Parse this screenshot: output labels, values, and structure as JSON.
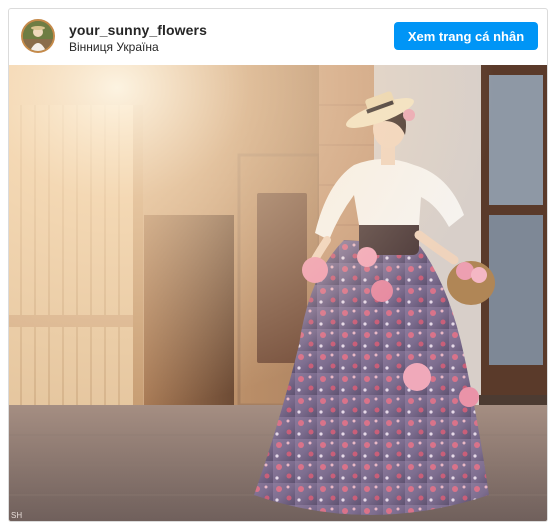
{
  "post": {
    "username": "your_sunny_flowers",
    "location": "Вінниця Україна",
    "profile_button_label": "Xem trang cá nhân"
  },
  "colors": {
    "button_bg": "#0095f6",
    "button_text": "#ffffff",
    "text": "#262626",
    "border": "#dbdbdb"
  },
  "icons": {
    "avatar": "profile-avatar"
  },
  "photo": {
    "watermark": "SH"
  }
}
